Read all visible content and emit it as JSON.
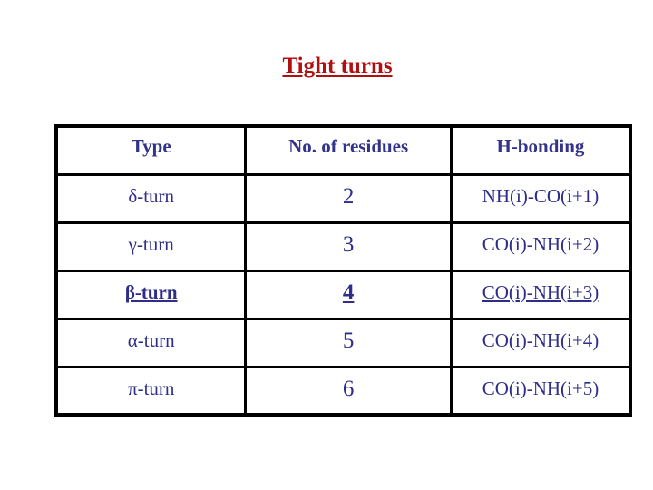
{
  "title": "Tight turns",
  "colors": {
    "title": "#b01010",
    "text": "#2e2e8a",
    "border": "#000000"
  },
  "table": {
    "headers": [
      "Type",
      "No. of residues",
      "H-bonding"
    ],
    "rows": [
      {
        "type": "δ-turn",
        "residues": "2",
        "hbond": "NH(i)-CO(i+1)"
      },
      {
        "type": "γ-turn",
        "residues": "3",
        "hbond": "CO(i)-NH(i+2)"
      },
      {
        "type": "β-turn",
        "residues": "4",
        "hbond": "CO(i)-NH(i+3)",
        "highlighted": true
      },
      {
        "type": "α-turn",
        "residues": "5",
        "hbond": "CO(i)-NH(i+4)"
      },
      {
        "type": "π-turn",
        "residues": "6",
        "hbond": "CO(i)-NH(i+5)"
      }
    ]
  }
}
